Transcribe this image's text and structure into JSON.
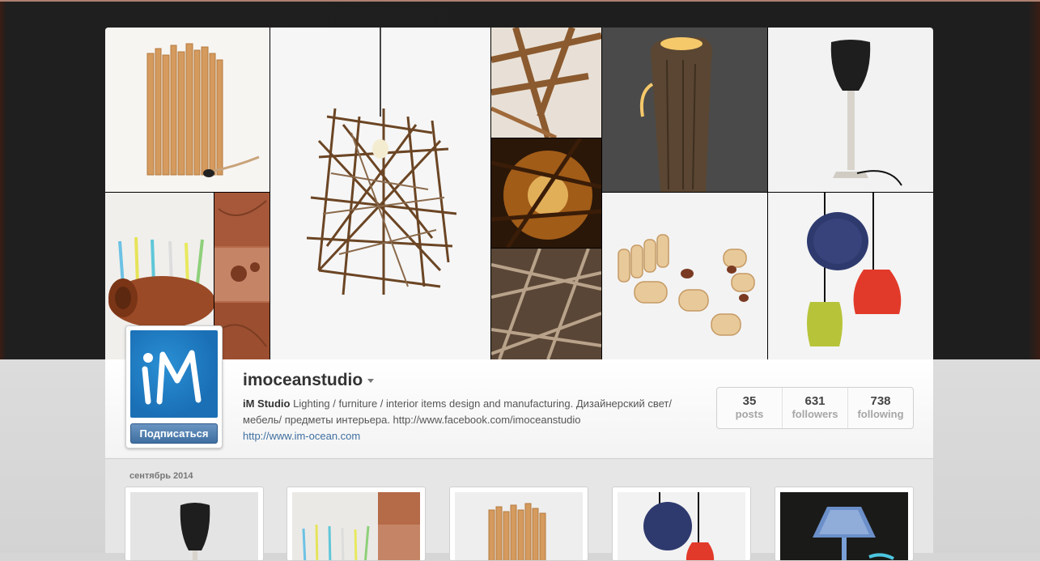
{
  "profile": {
    "username": "imoceanstudio",
    "subscribe_label": "Подписаться",
    "bio_name": "iM Studio",
    "bio_text": " Lighting / furniture / interior items design and manufacturing. Дизайнерский свет/ мебель/ предметы интерьера. http://www.facebook.com/imoceanstudio",
    "bio_link": "http://www.im-ocean.com",
    "avatar_text": "iM"
  },
  "stats": [
    {
      "count": "35",
      "label": "posts"
    },
    {
      "count": "631",
      "label": "followers"
    },
    {
      "count": "738",
      "label": "following"
    }
  ],
  "feed": {
    "month_label": "сентябрь 2014"
  },
  "colors": {
    "accent": "#3f6fa0",
    "avatar_blue": "#1a6fb5",
    "header_dark": "#1e1e1e"
  },
  "icons": {
    "dropdown": "caret-down-icon"
  }
}
